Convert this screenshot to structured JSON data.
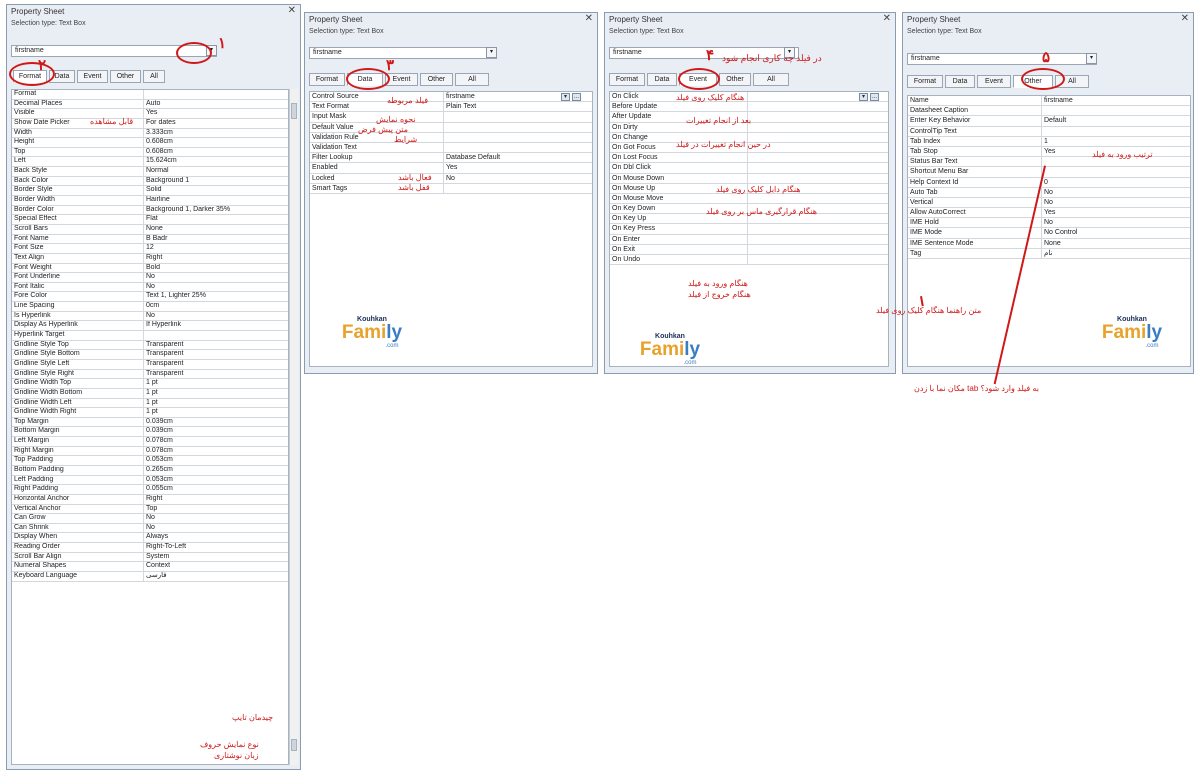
{
  "common": {
    "title": "Property Sheet",
    "close": "✕",
    "selection": "Selection type:  Text Box",
    "combo": "firstname",
    "drop": "▾",
    "tabs": [
      "Format",
      "Data",
      "Event",
      "Other",
      "All"
    ]
  },
  "numbers": [
    "۱",
    "۲",
    "۳",
    "۴",
    "۵"
  ],
  "panel1": {
    "rows": [
      [
        "Format",
        ""
      ],
      [
        "Decimal Places",
        "Auto"
      ],
      [
        "Visible",
        "Yes"
      ],
      [
        "Show Date Picker",
        "For dates"
      ],
      [
        "Width",
        "3.333cm"
      ],
      [
        "Height",
        "0.608cm"
      ],
      [
        "Top",
        "0.608cm"
      ],
      [
        "Left",
        "15.624cm"
      ],
      [
        "Back Style",
        "Normal"
      ],
      [
        "Back Color",
        "Background 1"
      ],
      [
        "Border Style",
        "Solid"
      ],
      [
        "Border Width",
        "Hairline"
      ],
      [
        "Border Color",
        "Background 1, Darker 35%"
      ],
      [
        "Special Effect",
        "Flat"
      ],
      [
        "Scroll Bars",
        "None"
      ],
      [
        "Font Name",
        "B Badr"
      ],
      [
        "Font Size",
        "12"
      ],
      [
        "Text Align",
        "Right"
      ],
      [
        "Font Weight",
        "Bold"
      ],
      [
        "Font Underline",
        "No"
      ],
      [
        "Font Italic",
        "No"
      ],
      [
        "Fore Color",
        "Text 1, Lighter 25%"
      ],
      [
        "Line Spacing",
        "0cm"
      ],
      [
        "Is Hyperlink",
        "No"
      ],
      [
        "Display As Hyperlink",
        "If Hyperlink"
      ],
      [
        "Hyperlink Target",
        ""
      ],
      [
        "Gridline Style Top",
        "Transparent"
      ],
      [
        "Gridline Style Bottom",
        "Transparent"
      ],
      [
        "Gridline Style Left",
        "Transparent"
      ],
      [
        "Gridline Style Right",
        "Transparent"
      ],
      [
        "Gridline Width Top",
        "1 pt"
      ],
      [
        "Gridline Width Bottom",
        "1 pt"
      ],
      [
        "Gridline Width Left",
        "1 pt"
      ],
      [
        "Gridline Width Right",
        "1 pt"
      ],
      [
        "Top Margin",
        "0.039cm"
      ],
      [
        "Bottom Margin",
        "0.039cm"
      ],
      [
        "Left Margin",
        "0.078cm"
      ],
      [
        "Right Margin",
        "0.078cm"
      ],
      [
        "Top Padding",
        "0.053cm"
      ],
      [
        "Bottom Padding",
        "0.265cm"
      ],
      [
        "Left Padding",
        "0.053cm"
      ],
      [
        "Right Padding",
        "0.055cm"
      ],
      [
        "Horizontal Anchor",
        "Right"
      ],
      [
        "Vertical Anchor",
        "Top"
      ],
      [
        "Can Grow",
        "No"
      ],
      [
        "Can Shrink",
        "No"
      ],
      [
        "Display When",
        "Always"
      ],
      [
        "Reading Order",
        "Right-To-Left"
      ],
      [
        "Scroll Bar Align",
        "System"
      ],
      [
        "Numeral Shapes",
        "Context"
      ],
      [
        "Keyboard Language",
        "فارسی"
      ]
    ],
    "annotations": [
      "قابل مشاهده",
      "چیدمان تایپ",
      "نوع نمایش حروف",
      "زبان نوشتاری"
    ]
  },
  "panel2": {
    "rows": [
      [
        "Control Source",
        "firstname"
      ],
      [
        "Text Format",
        "Plain Text"
      ],
      [
        "Input Mask",
        ""
      ],
      [
        "Default Value",
        ""
      ],
      [
        "Validation Rule",
        ""
      ],
      [
        "Validation Text",
        ""
      ],
      [
        "Filter Lookup",
        "Database Default"
      ],
      [
        "Enabled",
        "Yes"
      ],
      [
        "Locked",
        "No"
      ],
      [
        "Smart Tags",
        ""
      ]
    ],
    "annotations": [
      "فیلد مربوطه",
      "نحوه نمایش",
      "متن پیش فرض",
      "شرایط",
      "فعال باشد",
      "قفل باشد"
    ],
    "build_btn": "..."
  },
  "panel3": {
    "rows": [
      [
        "On Click",
        ""
      ],
      [
        "Before Update",
        ""
      ],
      [
        "After Update",
        ""
      ],
      [
        "On Dirty",
        ""
      ],
      [
        "On Change",
        ""
      ],
      [
        "On Got Focus",
        ""
      ],
      [
        "On Lost Focus",
        ""
      ],
      [
        "On Dbl Click",
        ""
      ],
      [
        "On Mouse Down",
        ""
      ],
      [
        "On Mouse Up",
        ""
      ],
      [
        "On Mouse Move",
        ""
      ],
      [
        "On Key Down",
        ""
      ],
      [
        "On Key Up",
        ""
      ],
      [
        "On Key Press",
        ""
      ],
      [
        "On Enter",
        ""
      ],
      [
        "On Exit",
        ""
      ],
      [
        "On Undo",
        ""
      ]
    ],
    "annotations": [
      "در فیلد چه کاری انجام شود",
      "هنگام کلیک روی فیلد",
      "بعد از انجام تغییرات",
      "در حین انجام تغییرات در فیلد",
      "هنگام دابل کلیک روی فیلد",
      "هنگام قرارگیری ماس بر روی فیلد",
      "هنگام ورود به فیلد",
      "هنگام خروج از فیلد"
    ],
    "build_btn": "..."
  },
  "panel4": {
    "rows": [
      [
        "Name",
        "firstname"
      ],
      [
        "Datasheet Caption",
        ""
      ],
      [
        "Enter Key Behavior",
        "Default"
      ],
      [
        "ControlTip Text",
        ""
      ],
      [
        "Tab Index",
        "1"
      ],
      [
        "Tab Stop",
        "Yes"
      ],
      [
        "Status Bar Text",
        ""
      ],
      [
        "Shortcut Menu Bar",
        ""
      ],
      [
        "Help Context Id",
        "0"
      ],
      [
        "Auto Tab",
        "No"
      ],
      [
        "Vertical",
        "No"
      ],
      [
        "Allow AutoCorrect",
        "Yes"
      ],
      [
        "IME Hold",
        "No"
      ],
      [
        "IME Mode",
        "No Control"
      ],
      [
        "IME Sentence Mode",
        "None"
      ],
      [
        "Tag",
        "نام"
      ]
    ],
    "annotations": [
      "ترتیب ورود به فیلد",
      "متن راهنما هنگام کلیک روی فیلد",
      "مکان نما با زدن tab به فیلد وارد شود؟"
    ]
  },
  "logo": {
    "top": "Kouhkan",
    "main_a": "Fami",
    "main_b": "ly",
    "com": ".com"
  },
  "colors": {
    "annotation": "#d01818",
    "panel_bg": "#e9eef5",
    "grid_line": "#d3d8df"
  }
}
